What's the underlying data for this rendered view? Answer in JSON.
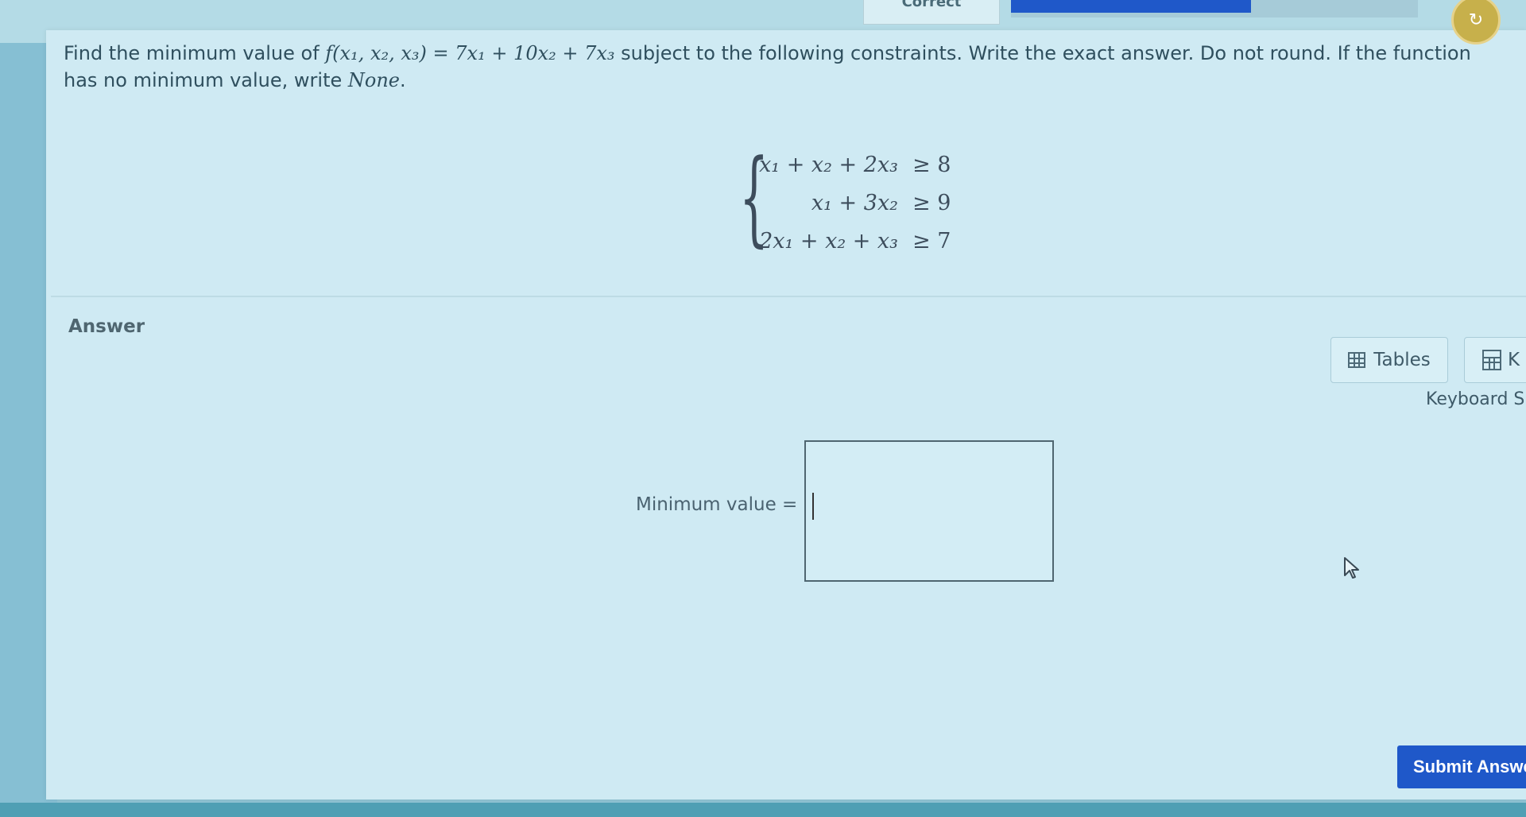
{
  "header": {
    "status_tab": "Correct",
    "progress_fraction": 0.59,
    "avatar_icon": "avatar-icon"
  },
  "question": {
    "prefix": "Find the minimum value of ",
    "function": "f(x₁, x₂, x₃) = 7x₁ + 10x₂ + 7x₃",
    "middle": " subject to the following constraints. Write the exact answer. Do not round. If the function has no minimum value, write ",
    "none_word": "None",
    "suffix": "."
  },
  "constraints": [
    {
      "lhs": "x₁ + x₂ + 2x₃",
      "rel": "≥ 8"
    },
    {
      "lhs": "x₁ + 3x₂",
      "rel": "≥ 9"
    },
    {
      "lhs": "2x₁ + x₂ + x₃",
      "rel": "≥ 7"
    }
  ],
  "answer": {
    "label": "Answer",
    "min_label": "Minimum value =",
    "input_value": "",
    "tables_label": "Tables",
    "keypad_label": "K",
    "keyboard_shortcuts": "Keyboard Sh",
    "submit_label": "Submit Answe"
  },
  "colors": {
    "accent": "#1f58c9",
    "panel": "#cfeaf3"
  }
}
